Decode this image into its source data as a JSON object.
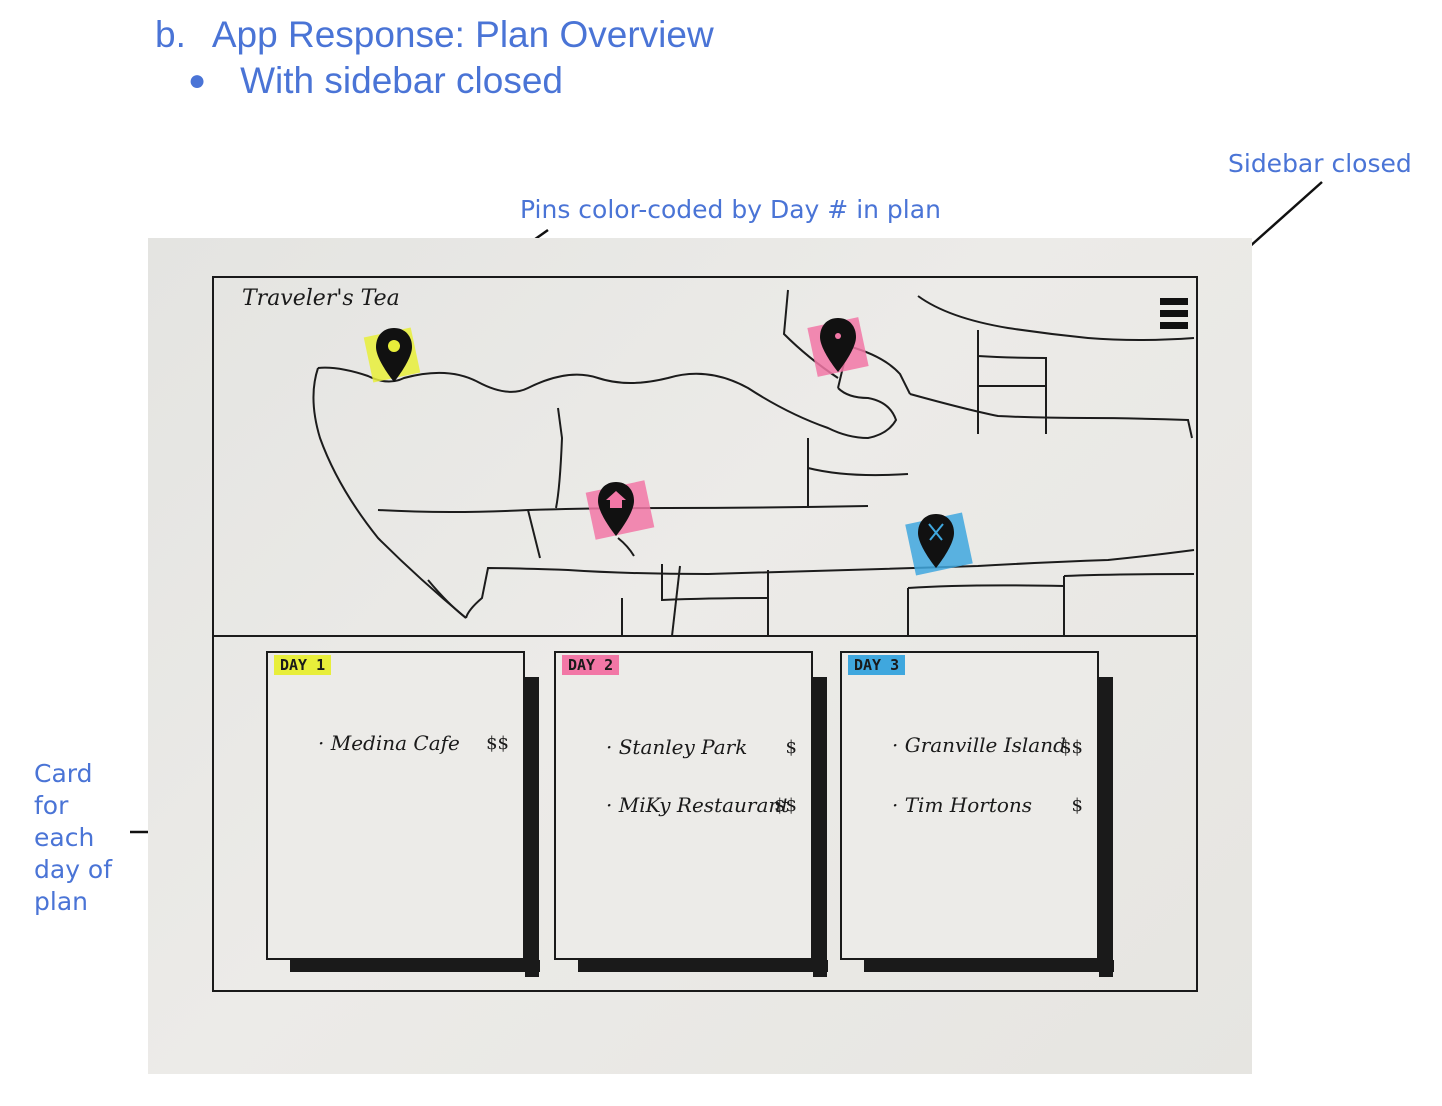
{
  "heading": {
    "marker1": "b.",
    "title": "App Response: Plan Overview",
    "marker2": "●",
    "subtitle": "With sidebar closed"
  },
  "annotations": {
    "sidebar": "Sidebar closed",
    "pins": "Pins color-coded by Day # in plan",
    "card": "Card for each day of plan"
  },
  "sketch": {
    "app_title": "Traveler's Tea",
    "menu_icon": "hamburger-menu-icon",
    "pins": [
      {
        "name": "pin-day1",
        "color": "#e8ee3a",
        "icon": "map-pin-icon"
      },
      {
        "name": "pin-day2-top",
        "color": "#f277a6",
        "icon": "map-pin-icon"
      },
      {
        "name": "pin-day2-middle",
        "color": "#f277a6",
        "icon": "home-pin-icon"
      },
      {
        "name": "pin-day3",
        "color": "#3fa7de",
        "icon": "restaurant-pin-icon"
      }
    ],
    "cards": [
      {
        "day": "DAY 1",
        "color": "#e8ee3a",
        "items": [
          {
            "name": "Medina Cafe",
            "price": "$$"
          }
        ]
      },
      {
        "day": "DAY 2",
        "color": "#f277a6",
        "items": [
          {
            "name": "Stanley Park",
            "price": "$"
          },
          {
            "name": "MiKy Restaurant",
            "price": "$$"
          }
        ]
      },
      {
        "day": "DAY 3",
        "color": "#3fa7de",
        "items": [
          {
            "name": "Granville Island",
            "price": "$$"
          },
          {
            "name": "Tim Hortons",
            "price": "$"
          }
        ]
      }
    ]
  }
}
